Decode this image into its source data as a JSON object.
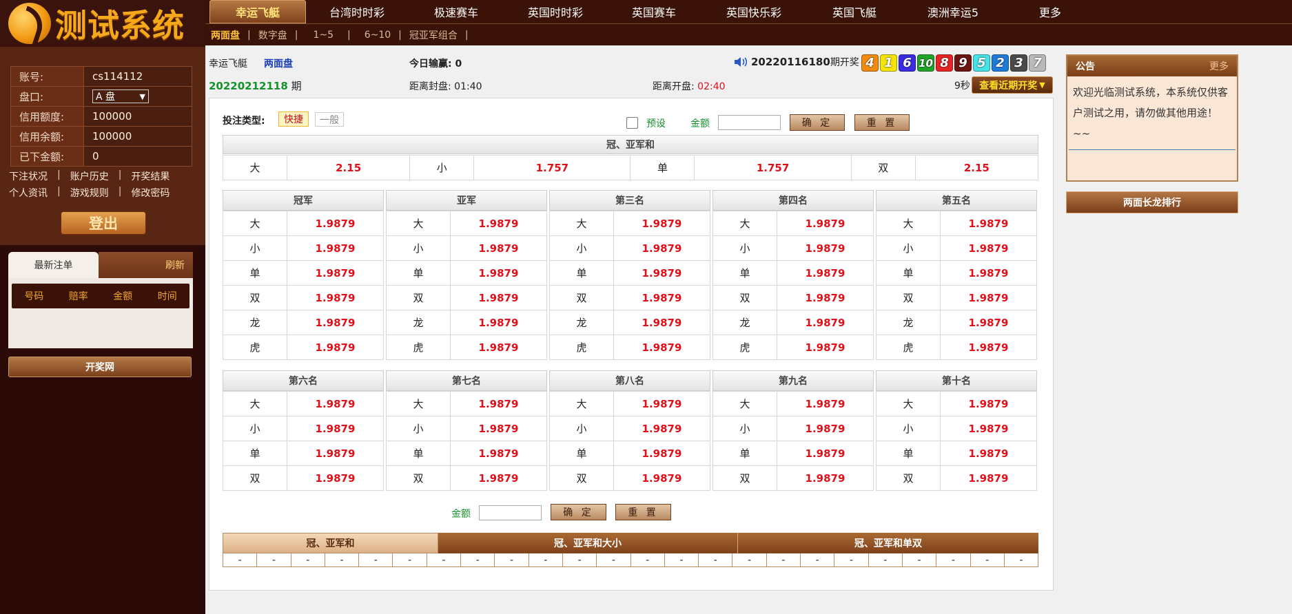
{
  "logo": {
    "text": "测试系统"
  },
  "user": {
    "rows": [
      {
        "label": "账号:",
        "value": "cs114112"
      },
      {
        "label": "盘口:",
        "value": "A 盘"
      },
      {
        "label": "信用额度:",
        "value": "100000"
      },
      {
        "label": "信用余额:",
        "value": "100000"
      },
      {
        "label": "已下金额:",
        "value": "0"
      }
    ],
    "links_row1": [
      "下注状况",
      "账户历史",
      "开奖结果"
    ],
    "links_row2": [
      "个人资讯",
      "游戏规则",
      "修改密码"
    ],
    "logout": "登出"
  },
  "recent_bets": {
    "tab_active": "最新注单",
    "tab_refresh": "刷新",
    "columns": [
      "号码",
      "赔率",
      "金额",
      "时间"
    ]
  },
  "kaijiang_link": "开奖网",
  "nav": {
    "items": [
      "幸运飞艇",
      "台湾时时彩",
      "极速赛车",
      "英国时时彩",
      "英国赛车",
      "英国快乐彩",
      "英国飞艇",
      "澳洲幸运5",
      "更多"
    ]
  },
  "subnav": {
    "items": [
      "两面盘",
      "数字盘",
      "1~5",
      "6~10",
      "冠亚军组合"
    ]
  },
  "game": {
    "name": "幸运飞艇",
    "mode": "两面盘",
    "today_win_label": "今日输赢:",
    "today_win": "0",
    "issue": "20220212118",
    "issue_suffix": "期",
    "close_label": "距离封盘:",
    "close_time": "01:40",
    "open_label": "距离开盘:",
    "open_time": "02:40",
    "last_issue": "20220116180",
    "last_issue_suffix": "期开奖",
    "countdown": "9秒",
    "recent_btn": "查看近期开奖",
    "balls": [
      {
        "n": "4",
        "color": "#f28b12"
      },
      {
        "n": "1",
        "color": "#f5e40a"
      },
      {
        "n": "6",
        "color": "#3a2ce0"
      },
      {
        "n": "10",
        "color": "#22a32a"
      },
      {
        "n": "8",
        "color": "#e52424"
      },
      {
        "n": "9",
        "color": "#6b1410"
      },
      {
        "n": "5",
        "color": "#45e2e6"
      },
      {
        "n": "2",
        "color": "#1f7bd8"
      },
      {
        "n": "3",
        "color": "#4a4a4a"
      },
      {
        "n": "7",
        "color": "#b9b9b9"
      }
    ]
  },
  "betform": {
    "type_label": "投注类型:",
    "type_fast": "快捷",
    "type_normal": "一般",
    "preset": "预设",
    "amount_label": "金额",
    "confirm": "确 定",
    "reset": "重 置"
  },
  "guanya": {
    "title": "冠、亚军和",
    "cells": [
      {
        "label": "大",
        "odds": "2.15"
      },
      {
        "label": "小",
        "odds": "1.757"
      },
      {
        "label": "单",
        "odds": "1.757"
      },
      {
        "label": "双",
        "odds": "2.15"
      }
    ]
  },
  "positions_top": [
    {
      "title": "冠军",
      "rows": [
        [
          "大",
          "1.9879"
        ],
        [
          "小",
          "1.9879"
        ],
        [
          "单",
          "1.9879"
        ],
        [
          "双",
          "1.9879"
        ],
        [
          "龙",
          "1.9879"
        ],
        [
          "虎",
          "1.9879"
        ]
      ]
    },
    {
      "title": "亚军",
      "rows": [
        [
          "大",
          "1.9879"
        ],
        [
          "小",
          "1.9879"
        ],
        [
          "单",
          "1.9879"
        ],
        [
          "双",
          "1.9879"
        ],
        [
          "龙",
          "1.9879"
        ],
        [
          "虎",
          "1.9879"
        ]
      ]
    },
    {
      "title": "第三名",
      "rows": [
        [
          "大",
          "1.9879"
        ],
        [
          "小",
          "1.9879"
        ],
        [
          "单",
          "1.9879"
        ],
        [
          "双",
          "1.9879"
        ],
        [
          "龙",
          "1.9879"
        ],
        [
          "虎",
          "1.9879"
        ]
      ]
    },
    {
      "title": "第四名",
      "rows": [
        [
          "大",
          "1.9879"
        ],
        [
          "小",
          "1.9879"
        ],
        [
          "单",
          "1.9879"
        ],
        [
          "双",
          "1.9879"
        ],
        [
          "龙",
          "1.9879"
        ],
        [
          "虎",
          "1.9879"
        ]
      ]
    },
    {
      "title": "第五名",
      "rows": [
        [
          "大",
          "1.9879"
        ],
        [
          "小",
          "1.9879"
        ],
        [
          "单",
          "1.9879"
        ],
        [
          "双",
          "1.9879"
        ],
        [
          "龙",
          "1.9879"
        ],
        [
          "虎",
          "1.9879"
        ]
      ]
    }
  ],
  "positions_bottom": [
    {
      "title": "第六名",
      "rows": [
        [
          "大",
          "1.9879"
        ],
        [
          "小",
          "1.9879"
        ],
        [
          "单",
          "1.9879"
        ],
        [
          "双",
          "1.9879"
        ]
      ]
    },
    {
      "title": "第七名",
      "rows": [
        [
          "大",
          "1.9879"
        ],
        [
          "小",
          "1.9879"
        ],
        [
          "单",
          "1.9879"
        ],
        [
          "双",
          "1.9879"
        ]
      ]
    },
    {
      "title": "第八名",
      "rows": [
        [
          "大",
          "1.9879"
        ],
        [
          "小",
          "1.9879"
        ],
        [
          "单",
          "1.9879"
        ],
        [
          "双",
          "1.9879"
        ]
      ]
    },
    {
      "title": "第九名",
      "rows": [
        [
          "大",
          "1.9879"
        ],
        [
          "小",
          "1.9879"
        ],
        [
          "单",
          "1.9879"
        ],
        [
          "双",
          "1.9879"
        ]
      ]
    },
    {
      "title": "第十名",
      "rows": [
        [
          "大",
          "1.9879"
        ],
        [
          "小",
          "1.9879"
        ],
        [
          "单",
          "1.9879"
        ],
        [
          "双",
          "1.9879"
        ]
      ]
    }
  ],
  "stat_tabs": [
    "冠、亚军和",
    "冠、亚军和大小",
    "冠、亚军和单双"
  ],
  "stat_cells": [
    "-",
    "-",
    "-",
    "-",
    "-",
    "-",
    "-",
    "-",
    "-",
    "-",
    "-",
    "-",
    "-",
    "-",
    "-",
    "-",
    "-",
    "-",
    "-",
    "-",
    "-",
    "-",
    "-",
    "-"
  ],
  "notice": {
    "title": "公告",
    "more": "更多",
    "text": "欢迎光临测试系统，本系统仅供客户测试之用，请勿做其他用途！~~"
  },
  "long_dragon": "两面长龙排行"
}
